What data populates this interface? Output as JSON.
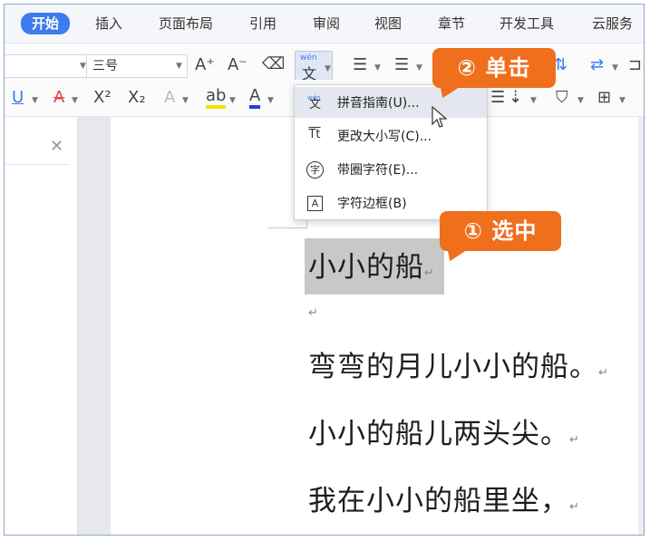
{
  "tabs": [
    "开始",
    "插入",
    "页面布局",
    "引用",
    "审阅",
    "视图",
    "章节",
    "开发工具",
    "云服务"
  ],
  "toolbar": {
    "font_size_value": "三号",
    "grow_font": "A⁺",
    "shrink_font": "A⁻",
    "pinyin_top": "wén",
    "pinyin_char": "文"
  },
  "menu": {
    "items": [
      {
        "icon_text": "文",
        "label": "拼音指南(U)..."
      },
      {
        "icon_text": "Tt",
        "label": "更改大小写(C)..."
      },
      {
        "icon_text": "字",
        "label": "带圈字符(E)..."
      },
      {
        "icon_text": "A",
        "label": "字符边框(B)"
      }
    ]
  },
  "callouts": {
    "step2": "② 单击",
    "step1": "① 选中"
  },
  "document": {
    "lines": [
      "小小的船",
      "弯弯的月儿小小的船。",
      "小小的船儿两头尖。",
      "我在小小的船里坐，"
    ],
    "para_mark": "↵"
  },
  "colors": {
    "accent": "#3d7bf0",
    "callout": "#ef6f1d",
    "selection": "#c8c8c8"
  }
}
